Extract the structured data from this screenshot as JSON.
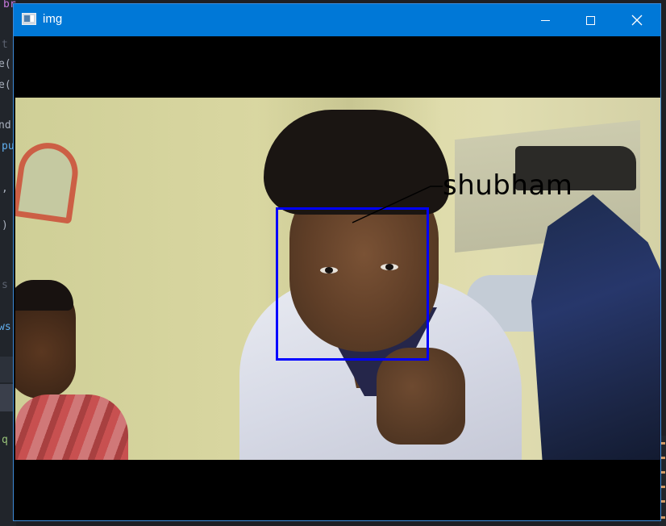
{
  "window": {
    "title": "img",
    "controls": {
      "minimize_icon": "minimize-icon",
      "maximize_icon": "maximize-icon",
      "close_icon": "close-icon"
    },
    "colors": {
      "titlebar": "#0078d7",
      "letterbox": "#000000"
    }
  },
  "image": {
    "detection": {
      "label": "shubham",
      "box_color": "#0000ff",
      "label_color": "#000000"
    }
  },
  "background_editor": {
    "left_fragments": [
      "br",
      "t",
      "e(",
      "e(",
      "nd",
      "pu",
      ",",
      ")",
      "s",
      "ws(",
      "q"
    ]
  }
}
